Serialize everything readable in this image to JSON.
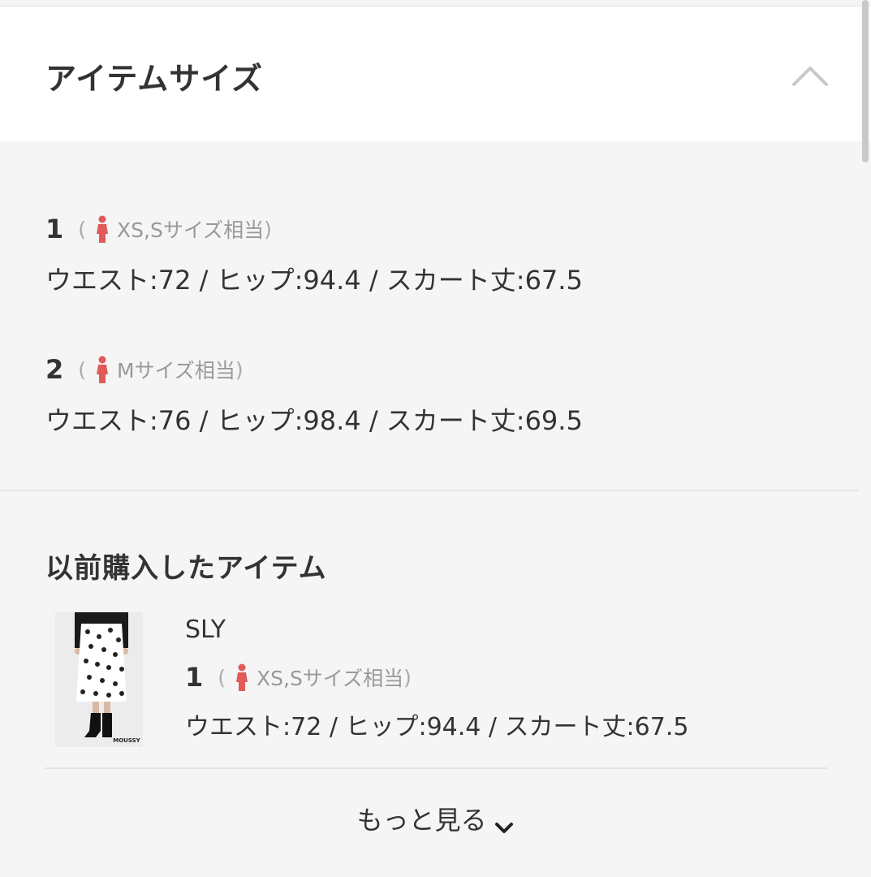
{
  "header": {
    "title": "アイテムサイズ",
    "collapse_icon": "chevron-up-icon"
  },
  "sizes": [
    {
      "number": "1",
      "equiv_open": "(",
      "equiv_text": "XS,Sサイズ相当",
      "equiv_close": ")",
      "measurements": "ウエスト:72 / ヒップ:94.4 / スカート丈:67.5"
    },
    {
      "number": "2",
      "equiv_open": "(",
      "equiv_text": "Mサイズ相当",
      "equiv_close": ")",
      "measurements": "ウエスト:76 / ヒップ:98.4 / スカート丈:69.5"
    }
  ],
  "purchased": {
    "title": "以前購入したアイテム",
    "item": {
      "brand": "SLY",
      "number": "1",
      "equiv_open": "(",
      "equiv_text": "XS,Sサイズ相当",
      "equiv_close": ")",
      "measurements": "ウエスト:72 / ヒップ:94.4 / スカート丈:67.5",
      "thumb_logo": "MOUSSY"
    }
  },
  "more": {
    "label": "もっと見る",
    "icon": "chevron-down-icon"
  },
  "colors": {
    "woman_icon": "#e05a5a",
    "text": "#333333",
    "muted": "#999999",
    "background": "#f5f5f5"
  }
}
